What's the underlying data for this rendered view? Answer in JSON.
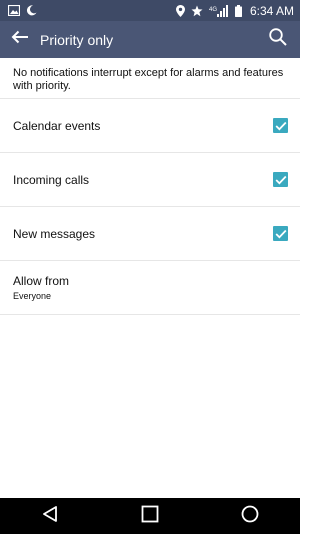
{
  "status_bar": {
    "time": "6:34 AM",
    "icons_left": [
      "image-icon",
      "moon-icon"
    ],
    "icons_right": [
      "location-icon",
      "star-icon",
      "4g-signal-icon",
      "battery-icon"
    ]
  },
  "app_bar": {
    "title": "Priority only",
    "background": "#4a5675"
  },
  "intro_text": "No notifications interrupt except for alarms and features with priority.",
  "settings": {
    "items": [
      {
        "label": "Calendar events",
        "checked": true
      },
      {
        "label": "Incoming calls",
        "checked": true
      },
      {
        "label": "New messages",
        "checked": true
      }
    ],
    "allow_from": {
      "label": "Allow from",
      "value": "Everyone"
    }
  },
  "colors": {
    "checkbox": "#3aa9bf",
    "status_bar": "#3e4a66"
  }
}
